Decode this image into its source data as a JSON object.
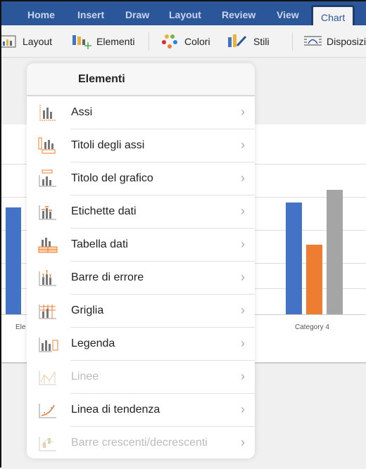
{
  "tabs": [
    "Home",
    "Insert",
    "Draw",
    "Layout",
    "Review",
    "View",
    "Chart"
  ],
  "active_tab": "Chart",
  "toolbar": {
    "layout": "Layout",
    "elementi": "Elementi",
    "colori": "Colori",
    "stili": "Stili",
    "disposizione": "Disposizi"
  },
  "chart": {
    "categories": [
      "Ele",
      "Category 4"
    ],
    "colors": {
      "series1": "#4472c4",
      "series2": "#ed7d31",
      "series3": "#a5a5a5"
    }
  },
  "popover": {
    "title": "Elementi",
    "items": [
      {
        "label": "Assi",
        "icon": "axes-icon",
        "enabled": true
      },
      {
        "label": "Titoli degli assi",
        "icon": "axis-titles-icon",
        "enabled": true
      },
      {
        "label": "Titolo del grafico",
        "icon": "chart-title-icon",
        "enabled": true
      },
      {
        "label": "Etichette dati",
        "icon": "data-labels-icon",
        "enabled": true
      },
      {
        "label": "Tabella dati",
        "icon": "data-table-icon",
        "enabled": true
      },
      {
        "label": "Barre di errore",
        "icon": "error-bars-icon",
        "enabled": true
      },
      {
        "label": "Griglia",
        "icon": "gridlines-icon",
        "enabled": true
      },
      {
        "label": "Legenda",
        "icon": "legend-icon",
        "enabled": true
      },
      {
        "label": "Linee",
        "icon": "lines-icon",
        "enabled": false
      },
      {
        "label": "Linea di tendenza",
        "icon": "trendline-icon",
        "enabled": true
      },
      {
        "label": "Barre crescenti/decrescenti",
        "icon": "up-down-bars-icon",
        "enabled": false
      }
    ]
  }
}
